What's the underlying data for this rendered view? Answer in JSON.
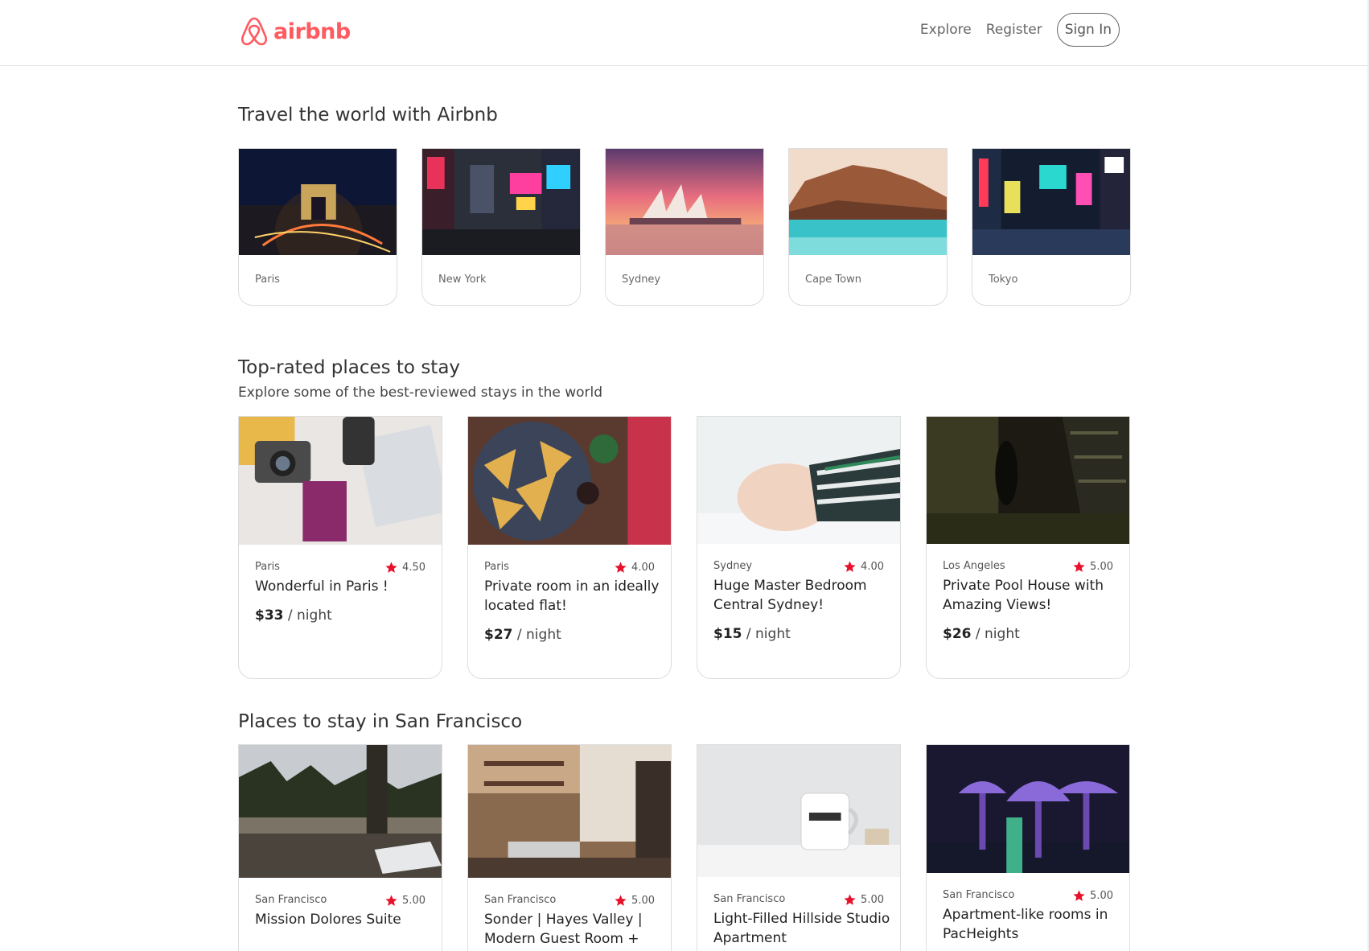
{
  "header": {
    "logo_text": "airbnb",
    "nav": {
      "explore": "Explore",
      "register": "Register",
      "sign_in": "Sign In"
    }
  },
  "colors": {
    "brand": "#ff5a5f",
    "star": "#e8102a"
  },
  "travel": {
    "title": "Travel the world with Airbnb",
    "cities": [
      {
        "name": "Paris"
      },
      {
        "name": "New York"
      },
      {
        "name": "Sydney"
      },
      {
        "name": "Cape Town"
      },
      {
        "name": "Tokyo"
      }
    ]
  },
  "top_rated": {
    "title": "Top-rated places to stay",
    "subtitle": "Explore some of the best-reviewed stays in the world",
    "listings": [
      {
        "city": "Paris",
        "rating": "4.50",
        "title": "Wonderful in Paris !",
        "price": "$33",
        "per": " / night"
      },
      {
        "city": "Paris",
        "rating": "4.00",
        "title": "Private room in an ideally located flat!",
        "price": "$27",
        "per": " / night"
      },
      {
        "city": "Sydney",
        "rating": "4.00",
        "title": "Huge Master Bedroom Central Sydney!",
        "price": "$15",
        "per": " / night"
      },
      {
        "city": "Los Angeles",
        "rating": "5.00",
        "title": "Private Pool House with Amazing Views!",
        "price": "$26",
        "per": " / night"
      }
    ]
  },
  "san_francisco": {
    "title": "Places to stay in San Francisco",
    "listings": [
      {
        "city": "San Francisco",
        "rating": "5.00",
        "title": "Mission Dolores Suite"
      },
      {
        "city": "San Francisco",
        "rating": "5.00",
        "title": "Sonder | Hayes Valley | Modern Guest Room +"
      },
      {
        "city": "San Francisco",
        "rating": "5.00",
        "title": "Light-Filled Hillside Studio Apartment"
      },
      {
        "city": "San Francisco",
        "rating": "5.00",
        "title": "Apartment-like rooms in PacHeights"
      }
    ]
  }
}
